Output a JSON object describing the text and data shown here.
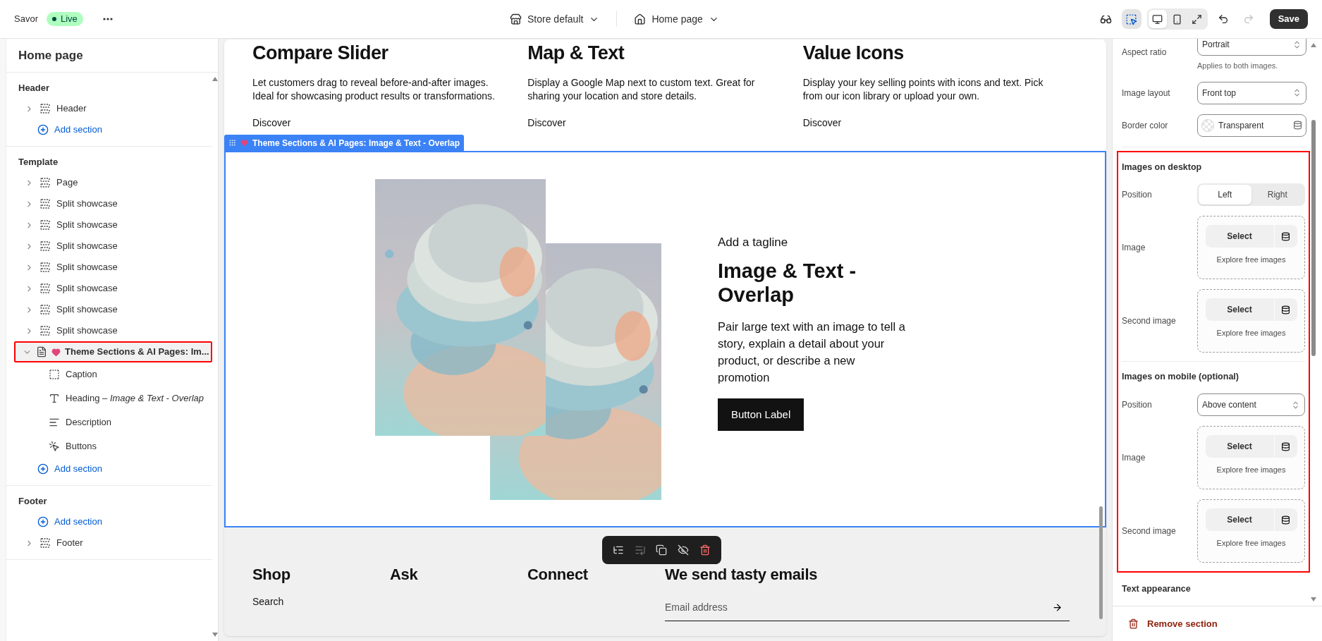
{
  "top_bar": {
    "store": "Savor",
    "status": "Live",
    "store_menu": "Store default",
    "page_menu": "Home page",
    "inspector_on": true,
    "view_modes": [
      {
        "selected": true
      },
      {
        "selected": false
      },
      {
        "selected": false
      }
    ],
    "save": "Save"
  },
  "sidebar": {
    "title": "Home page",
    "groups": [
      {
        "label": "Header",
        "items": [
          {
            "kind": "section",
            "label": "Header",
            "expanded": false
          },
          {
            "kind": "add",
            "label": "Add section"
          }
        ]
      },
      {
        "label": "Template",
        "items": [
          {
            "kind": "section",
            "label": "Page",
            "expanded": false
          },
          {
            "kind": "section",
            "label": "Split showcase",
            "expanded": false
          },
          {
            "kind": "section",
            "label": "Split showcase",
            "expanded": false
          },
          {
            "kind": "section",
            "label": "Split showcase",
            "expanded": false
          },
          {
            "kind": "section",
            "label": "Split showcase",
            "expanded": false
          },
          {
            "kind": "section",
            "label": "Split showcase",
            "expanded": false
          },
          {
            "kind": "section",
            "label": "Split showcase",
            "expanded": false
          },
          {
            "kind": "section",
            "label": "Split showcase",
            "expanded": false
          },
          {
            "kind": "app_section",
            "label": "Theme Sections & AI Pages: Im...",
            "expanded": true,
            "highlighted": true,
            "children": [
              {
                "kind": "caption",
                "label": "Caption"
              },
              {
                "kind": "heading",
                "label": "Heading – *Image & Text - Overlap*"
              },
              {
                "kind": "text",
                "label": "Description"
              },
              {
                "kind": "buttons",
                "label": "Buttons"
              }
            ]
          },
          {
            "kind": "add",
            "label": "Add section"
          }
        ]
      },
      {
        "label": "Footer",
        "items": [
          {
            "kind": "add",
            "label": "Add section"
          },
          {
            "kind": "section",
            "label": "Footer",
            "expanded": false
          }
        ]
      }
    ]
  },
  "preview": {
    "columns": [
      {
        "heading": "Compare Slider",
        "text": "Let customers drag to reveal before-and-after images. Ideal for showcasing product results or transformations.",
        "link": "Discover"
      },
      {
        "heading": "Map & Text",
        "text": "Display a Google Map next to custom text. Great for sharing your location and store details.",
        "link": "Discover"
      },
      {
        "heading": "Value Icons",
        "text": "Display your key selling points with icons and text. Pick from our icon library or upload your own.",
        "link": "Discover"
      }
    ],
    "section_tab": "Theme Sections & AI Pages: Image & Text - Overlap",
    "tagline": "Add a tagline",
    "heading": "Image & Text - Overlap",
    "description": "Pair large text with an image to tell a story, explain a detail about your product, or describe a new promotion",
    "button": "Button Label",
    "footer": {
      "columns": [
        {
          "heading": "Shop",
          "links": [
            "Search"
          ]
        },
        {
          "heading": "Ask"
        },
        {
          "heading": "Connect"
        }
      ],
      "newsletter": {
        "heading": "We send tasty emails",
        "placeholder": "Email address"
      }
    }
  },
  "settings": {
    "fields": [
      {
        "kind": "select",
        "label": "Aspect ratio",
        "value": "Portrait",
        "help": "Applies to both images."
      },
      {
        "kind": "select",
        "label": "Image layout",
        "value": "Front top"
      },
      {
        "kind": "color",
        "label": "Border color",
        "value": "Transparent"
      }
    ],
    "highlighted_groups": [
      {
        "title": "Images on desktop",
        "fields": [
          {
            "kind": "segmented",
            "label": "Position",
            "options": [
              {
                "label": "Left",
                "selected": true
              },
              {
                "label": "Right",
                "selected": false
              }
            ]
          },
          {
            "label": "Image",
            "button": "Select",
            "link": "Explore free images"
          },
          {
            "label": "Second image",
            "button": "Select",
            "link": "Explore free images"
          }
        ]
      },
      {
        "title": "Images on mobile (optional)",
        "fields": [
          {
            "kind": "select",
            "label": "Position",
            "value": "Above content"
          },
          {
            "label": "Image",
            "button": "Select",
            "link": "Explore free images"
          },
          {
            "label": "Second image",
            "button": "Select",
            "link": "Explore free images"
          }
        ]
      }
    ],
    "next_group": "Text appearance",
    "remove": "Remove section"
  }
}
